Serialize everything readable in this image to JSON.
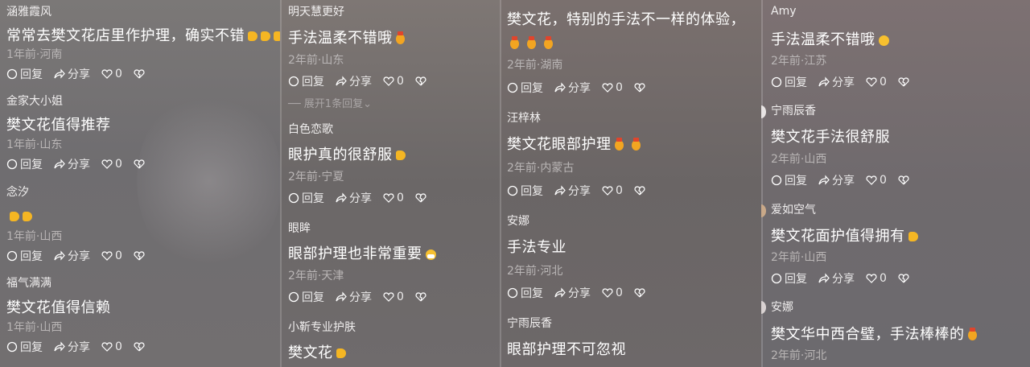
{
  "actions": {
    "reply": "回复",
    "share": "分享",
    "likes": "0"
  },
  "col1": [
    {
      "name": "涵雅霞风",
      "text": "常常去樊文花店里作护理，确实不错",
      "meta": "1年前·河南"
    },
    {
      "name": "金家大小姐",
      "text": "樊文花值得推荐",
      "meta": "1年前·山东"
    },
    {
      "name": "念汐",
      "text": "",
      "meta": "1年前·山西"
    },
    {
      "name": "福气满满",
      "text": "樊文花值得信赖",
      "meta": "1年前·山西"
    }
  ],
  "col2": [
    {
      "name": "明天慧更好",
      "text": "手法温柔不错哦",
      "meta": "2年前·山东",
      "expand": "展开1条回复"
    },
    {
      "name": "白色恋歌",
      "text": "眼护真的很舒服",
      "meta": "2年前·宁夏"
    },
    {
      "name": "眼眸",
      "text": "眼部护理也非常重要",
      "meta": "2年前·天津"
    },
    {
      "name": "小靳专业护肤",
      "text": "樊文花"
    }
  ],
  "col3": [
    {
      "text": "樊文花，特别的手法不一样的体验，",
      "meta": "2年前·湖南"
    },
    {
      "name": "汪梓林",
      "text": "樊文花眼部护理",
      "meta": "2年前·内蒙古"
    },
    {
      "name": "安娜",
      "text": "手法专业",
      "meta": "2年前·河北"
    },
    {
      "name": "宁雨辰香",
      "text": "眼部护理不可忽视"
    }
  ],
  "col4": [
    {
      "name": "Amy",
      "text": "手法温柔不错哦",
      "meta": "2年前·江苏"
    },
    {
      "name": "宁雨辰香",
      "text": "樊文花手法很舒服",
      "meta": "2年前·山西"
    },
    {
      "name": "爱如空气",
      "text": "樊文花面护值得拥有",
      "meta": "2年前·山西"
    },
    {
      "name": "安娜",
      "text": "樊文华中西合璧，手法棒棒的",
      "meta": "2年前·河北"
    }
  ]
}
